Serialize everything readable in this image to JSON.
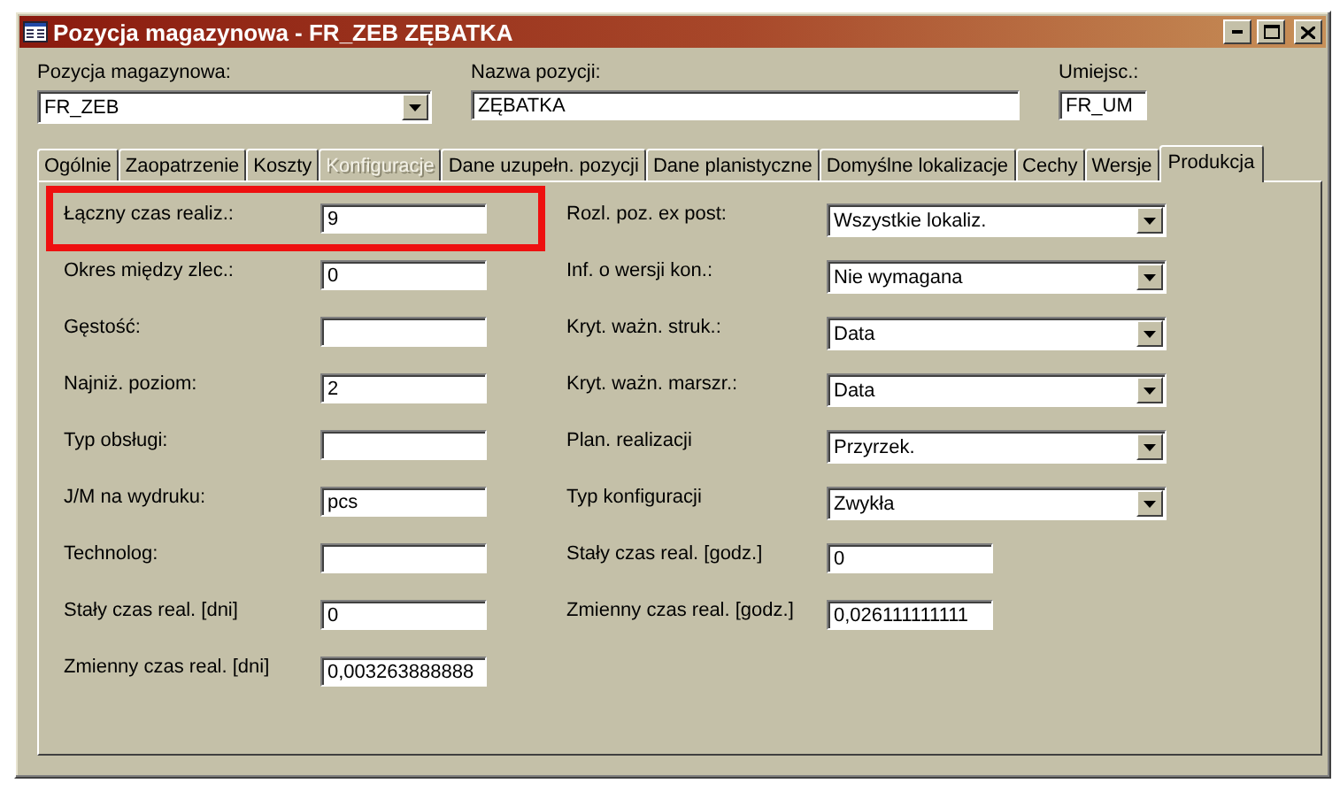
{
  "window": {
    "title": "Pozycja magazynowa - FR_ZEB ZĘBATKA"
  },
  "header_fields": [
    {
      "label": "Pozycja magazynowa:",
      "value": "FR_ZEB",
      "kind": "dropdown"
    },
    {
      "label": "Nazwa pozycji:",
      "value": "ZĘBATKA",
      "kind": "text"
    },
    {
      "label": "Umiejsc.:",
      "value": "FR_UM",
      "kind": "text"
    }
  ],
  "tabs": [
    {
      "label": "Ogólnie",
      "selected": false,
      "disabled": false
    },
    {
      "label": "Zaopatrzenie",
      "selected": false,
      "disabled": false
    },
    {
      "label": "Koszty",
      "selected": false,
      "disabled": false
    },
    {
      "label": "Konfiguracje",
      "selected": false,
      "disabled": true
    },
    {
      "label": "Dane uzupełn. pozycji",
      "selected": false,
      "disabled": false
    },
    {
      "label": "Dane planistyczne",
      "selected": false,
      "disabled": false
    },
    {
      "label": "Domyślne lokalizacje",
      "selected": false,
      "disabled": false
    },
    {
      "label": "Cechy",
      "selected": false,
      "disabled": false
    },
    {
      "label": "Wersje",
      "selected": false,
      "disabled": false
    },
    {
      "label": "Produkcja",
      "selected": true,
      "disabled": false
    }
  ],
  "left_fields": [
    {
      "label": "Łączny czas realiz.:",
      "value": "9",
      "kind": "highlighted"
    },
    {
      "label": "Okres między zlec.:",
      "value": "0",
      "kind": "plain"
    },
    {
      "label": "Gęstość:",
      "kind": "plain"
    },
    {
      "label": "Najniż. poziom:",
      "value": "2",
      "kind": "plain"
    },
    {
      "label": "Typ obsługi:",
      "kind": "plain"
    },
    {
      "label": "J/M na wydruku:",
      "value": "pcs",
      "kind": "plain"
    },
    {
      "label": "Technolog:",
      "kind": "plain"
    },
    {
      "label": "Stały czas real. [dni]",
      "value": "0",
      "kind": "plain"
    },
    {
      "label": "Zmienny czas real. [dni]",
      "value": "0,003263888888",
      "kind": "plain"
    }
  ],
  "right_fields": [
    {
      "label": "Rozl. poz. ex post:",
      "value": "Wszystkie lokaliz.",
      "kind": "dropdown"
    },
    {
      "label": "Inf. o wersji kon.:",
      "value": "Nie wymagana",
      "kind": "dropdown"
    },
    {
      "label": "Kryt. ważn. struk.:",
      "value": "Data",
      "kind": "dropdown"
    },
    {
      "label": "Kryt. ważn. marszr.:",
      "value": "Data",
      "kind": "dropdown"
    },
    {
      "label": "Plan. realizacji",
      "value": "Przyrzek.",
      "kind": "dropdown"
    },
    {
      "label": "Typ konfiguracji",
      "value": "Zwykła",
      "kind": "dropdown"
    },
    {
      "label": "Stały czas real. [godz.]",
      "value": "0",
      "kind": "text"
    },
    {
      "label": "Zmienny czas real. [godz.]",
      "value": "0,026111111111",
      "kind": "text"
    }
  ]
}
